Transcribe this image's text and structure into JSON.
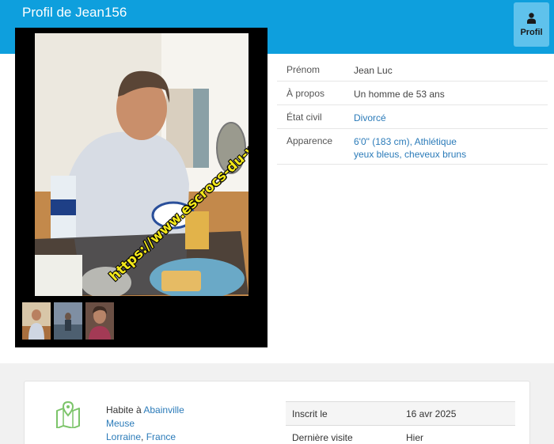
{
  "header": {
    "title": "Profil de Jean156",
    "profil_button_label": "Profil",
    "profil_icon": "user-icon"
  },
  "photo": {
    "watermark": "https://www.escrocs-du-web.fr",
    "thumbnails": [
      "thumbnail-1",
      "thumbnail-2",
      "thumbnail-3"
    ]
  },
  "details": {
    "prenom_label": "Prénom",
    "prenom_value": "Jean Luc",
    "apropos_label": "À propos",
    "apropos_value": "Un homme de 53 ans",
    "etat_label": "État civil",
    "etat_value": "Divorcé",
    "apparence_label": "Apparence",
    "apparence_line1": "6'0\" (183 cm), Athlétique",
    "apparence_line2": "yeux bleus, cheveux bruns"
  },
  "location": {
    "icon": "map-marker-icon",
    "prefix": "Habite à",
    "city": "Abainville",
    "department": "Meuse",
    "region": "Lorraine",
    "country": "France"
  },
  "stats": {
    "inscrit_label": "Inscrit le",
    "inscrit_value": "16 avr 2025",
    "visite_label": "Dernière visite",
    "visite_value": "Hier"
  },
  "colors": {
    "header": "#0e9fdd",
    "link": "#2b7bb9",
    "watermark": "#f3e81a"
  }
}
